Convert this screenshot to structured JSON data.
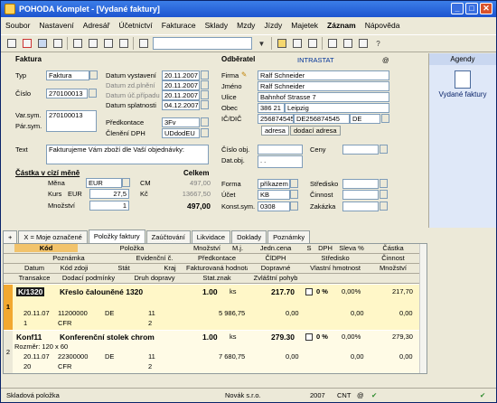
{
  "window": {
    "title": "POHODA Komplet - [Vydané faktury]"
  },
  "menu": [
    "Soubor",
    "Nastavení",
    "Adresář",
    "Účetnictví",
    "Fakturace",
    "Sklady",
    "Mzdy",
    "Jízdy",
    "Majetek",
    "Záznam",
    "Nápověda"
  ],
  "faktura": {
    "section": "Faktura",
    "typ_label": "Typ",
    "typ": "Faktura",
    "cislo_label": "Číslo",
    "cislo": "270100013",
    "varsym_label": "Var.sym.",
    "varsym": "270100013",
    "parsym_label": "Pár.sym.",
    "datum_vystaveni_label": "Datum vystavení",
    "datum_vystaveni": "20.11.2007",
    "datum_zd_label": "Datum zd.plnění",
    "datum_zd": "20.11.2007",
    "datum_uc_label": "Datum úč.případu",
    "datum_uc": "20.11.2007",
    "datum_splat_label": "Datum splatnosti",
    "datum_splat": "04.12.2007",
    "predkontace_label": "Předkontace",
    "predkontace": "3Fv",
    "cleneni_label": "Členění DPH",
    "cleneni": "UDdodEU",
    "text_label": "Text",
    "text": "Fakturujeme Vám zboží dle Vaší objednávky:"
  },
  "castka": {
    "section": "Částka v cizí měně",
    "celkem_label": "Celkem",
    "mena_label": "Měna",
    "mena": "EUR",
    "kurs_label": "Kurs",
    "kurs_mena": "EUR",
    "kurs": "27,5",
    "mnozstvi_label": "Množství",
    "mnozstvi": "1",
    "cm_label": "CM",
    "cm": "497,00",
    "kc_label": "Kč",
    "kc": "13667,50",
    "celkem": "497,00"
  },
  "odberatel": {
    "section": "Odběratel",
    "intrastat": "INTRASTAT",
    "at": "@",
    "firma_label": "Firma",
    "firma": "Ralf Schneider",
    "jmeno_label": "Jméno",
    "jmeno": "Ralf Schneider",
    "ulice_label": "Ulice",
    "ulice": "Bahnhof Strasse 7",
    "obec_label": "Obec",
    "psc": "386 21",
    "obec": "Leipzig",
    "ic_label": "IČ/DIČ",
    "ic": "256874545",
    "dic": "DE256874545",
    "stat": "DE",
    "tab_adresa": "adresa",
    "tab_dodaci": "dodací adresa",
    "cislo_obj_label": "Číslo obj.",
    "dat_obj_label": "Dat.obj.",
    "dat_obj": ". .",
    "ceny_label": "Ceny",
    "forma_label": "Forma",
    "forma": "příkazem",
    "ucet_label": "Účet",
    "ucet": "KB",
    "konst_label": "Konst.sym.",
    "konst": "0308",
    "stredisko_label": "Středisko",
    "cinnost_label": "Činnost",
    "zakazka_label": "Zakázka"
  },
  "agenda": {
    "header": "Agendy",
    "item": "Vydané faktury"
  },
  "tabs": [
    "+",
    "X = Moje označené",
    "Položky faktury",
    "Zaúčtování",
    "Likvidace",
    "Doklady",
    "Poznámky"
  ],
  "grid_headers": [
    [
      "Kód",
      "Položka",
      "Množství",
      "M.j.",
      "Jedn.cena",
      "S",
      "DPH",
      "Sleva %",
      "Částka"
    ],
    [
      "Poznámka",
      "Evidenční č.",
      "Předkontace",
      "ČlDPH",
      "Středisko",
      "Činnost"
    ],
    [
      "Datum",
      "Kód zdoji",
      "Stát",
      "Kraj",
      "Fakturovaná hodnota",
      "Dopravné",
      "Vlastní hmotnost",
      "Množství"
    ],
    [
      "Transakce",
      "Dodací podmínky",
      "Druh dopravy",
      "Stat.znak",
      "Zvláštní pohyb"
    ]
  ],
  "rows": [
    {
      "num": "1",
      "kod": "K/1320",
      "nazev": "Křeslo čalouněné 1320",
      "mnozstvi": "1.00",
      "mj": "ks",
      "cena": "217.70",
      "dph": "0 %",
      "sleva": "0,00%",
      "castka": "217,70",
      "datum": "20.11.07",
      "kod2": "11200000",
      "stat": "DE",
      "kraj": "11",
      "hodnota": "5 986,75",
      "doprava": "0,00",
      "hmot": "0,00",
      "mnoz2": "0,00",
      "trans": "1",
      "podm": "CFR",
      "druh": "2",
      "poznamka": ""
    },
    {
      "num": "2",
      "kod": "Konf11",
      "nazev": "Konferenční stolek chrom",
      "mnozstvi": "1.00",
      "mj": "ks",
      "cena": "279.30",
      "dph": "0 %",
      "sleva": "0,00%",
      "castka": "279,30",
      "datum": "20.11.07",
      "kod2": "22300000",
      "stat": "DE",
      "kraj": "11",
      "hodnota": "7 680,75",
      "doprava": "0,00",
      "hmot": "0,00",
      "mnoz2": "0,00",
      "trans": "20",
      "podm": "CFR",
      "druh": "2",
      "poznamka": "Rozměr: 120 x 60"
    }
  ],
  "status": {
    "left": "Skladová položka",
    "firma": "Novák s.r.o.",
    "rok": "2007",
    "cnt": "CNT"
  },
  "colors": {
    "title": "#1d55d0",
    "selected_row": "#fff7c8",
    "highlight_cell": "#1a1a1a"
  }
}
